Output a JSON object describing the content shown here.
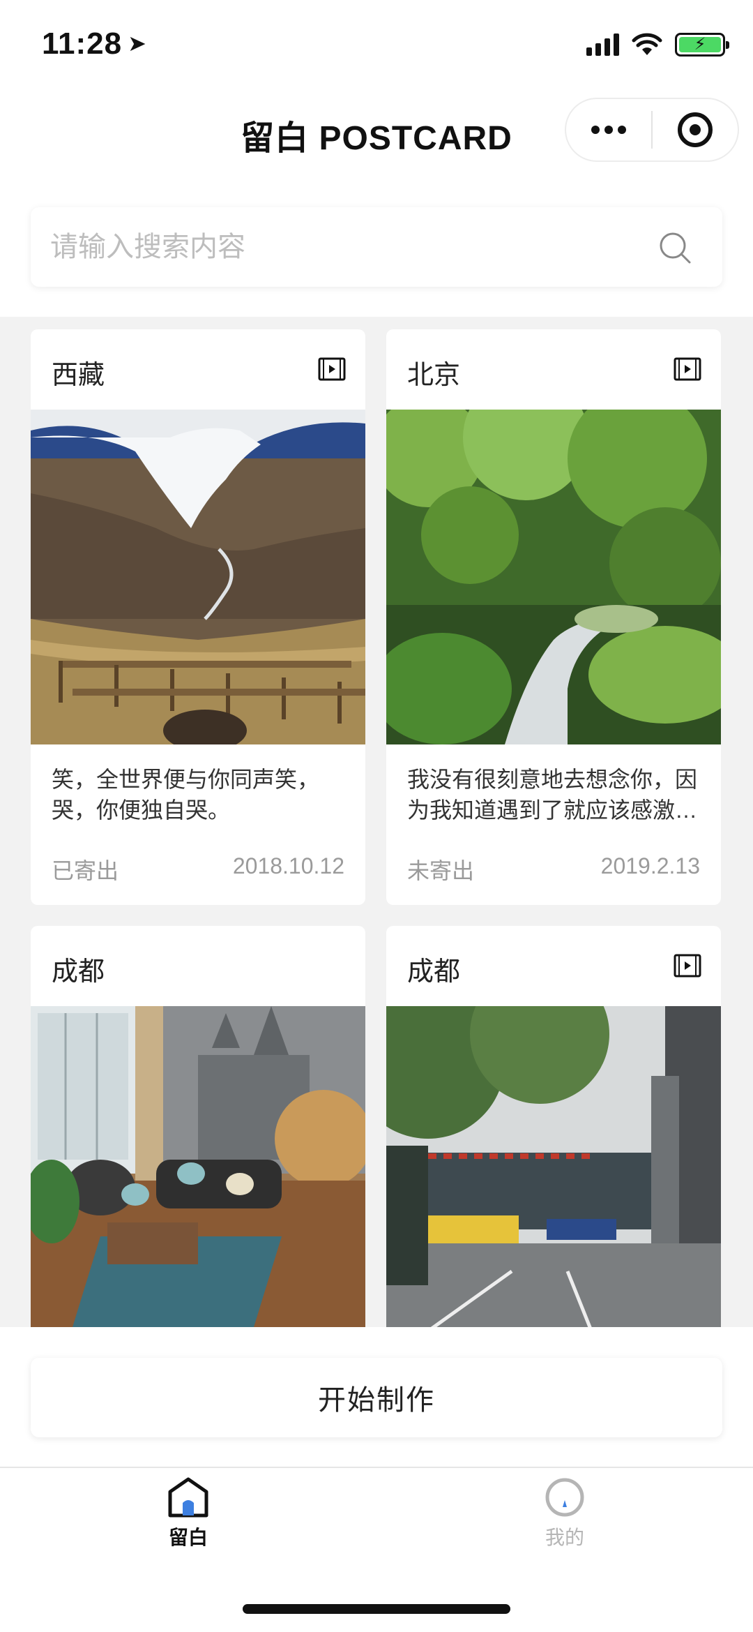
{
  "status_bar": {
    "time": "11:28"
  },
  "header": {
    "title": "留白 POSTCARD"
  },
  "search": {
    "placeholder": "请输入搜索内容"
  },
  "cards": [
    {
      "city": "西藏",
      "text": "笑，全世界便与你同声笑，哭，你便独自哭。",
      "status": "已寄出",
      "date": "2018.10.12",
      "has_video": true
    },
    {
      "city": "北京",
      "text": "我没有很刻意地去想念你，因为我知道遇到了就应该感激，离开了就应该怀念。",
      "status": "未寄出",
      "date": "2019.2.13",
      "has_video": true
    },
    {
      "city": "成都",
      "has_video": false
    },
    {
      "city": "成都",
      "has_video": true
    }
  ],
  "actions": {
    "start_label": "开始制作"
  },
  "tabbar": {
    "home_label": "留白",
    "mine_label": "我的"
  },
  "colors": {
    "accent_blue": "#3d7fe0",
    "battery_green": "#4cd964"
  }
}
